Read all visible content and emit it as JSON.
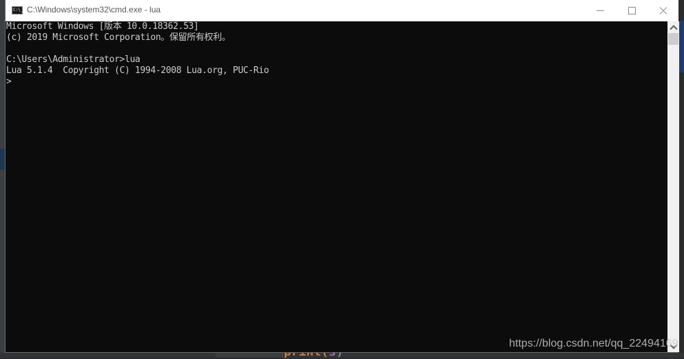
{
  "window": {
    "title": "C:\\Windows\\system32\\cmd.exe - lua",
    "icon": "cmd-icon",
    "icon_text": "C:\\_",
    "controls": {
      "minimize": "minimize-icon",
      "maximize": "maximize-icon",
      "close": "close-icon"
    }
  },
  "console": {
    "lines": [
      "Microsoft Windows [版本 10.0.18362.53]",
      "(c) 2019 Microsoft Corporation。保留所有权利。",
      "",
      "C:\\Users\\Administrator>lua",
      "Lua 5.1.4  Copyright (C) 1994-2008 Lua.org, PUC-Rio",
      ">"
    ],
    "colors": {
      "background": "#0c0c0c",
      "foreground": "#cccccc"
    }
  },
  "scrollbar": {
    "up": "scroll-up-icon",
    "down": "scroll-down-icon"
  },
  "watermark": "https://blog.csdn.net/qq_22494169",
  "background_app": {
    "code_fragment": "print(",
    "code_fragment_arg": "s)"
  }
}
